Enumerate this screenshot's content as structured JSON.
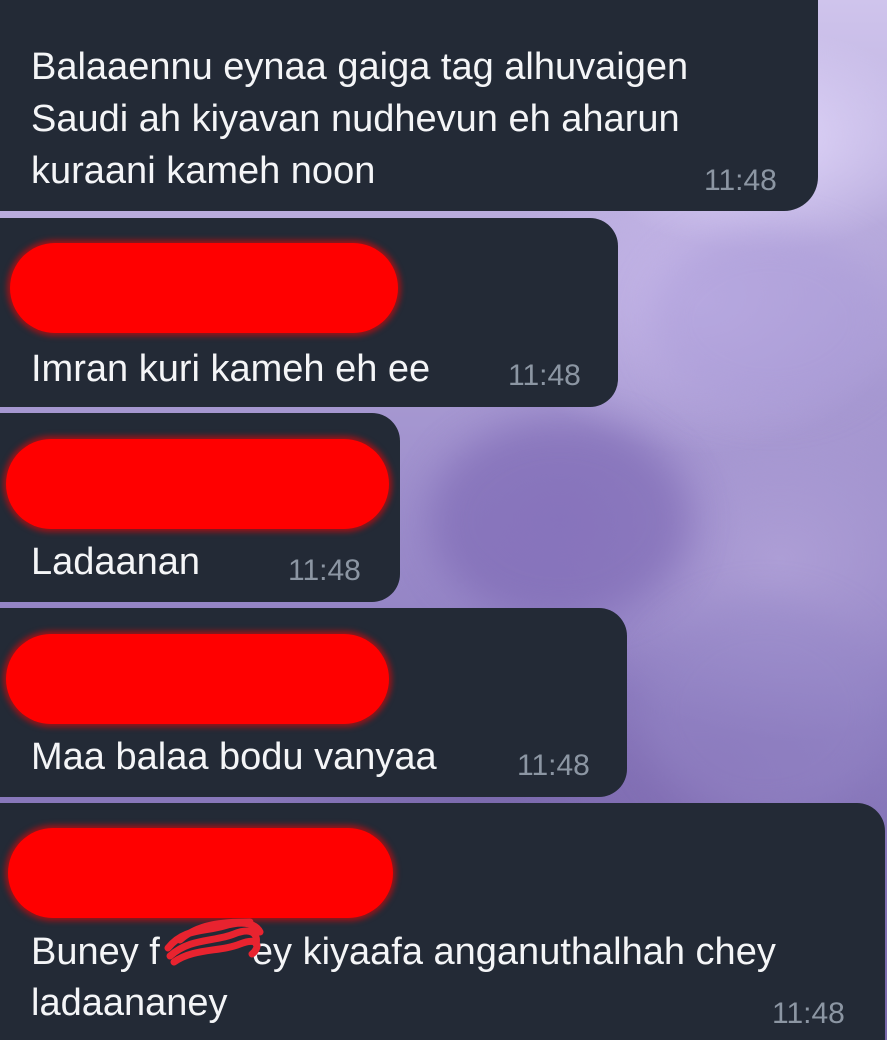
{
  "messages": [
    {
      "id": "m1",
      "text_lines": [
        "Balaaennu eynaa gaiga tag alhuvaigen",
        "Saudi ah kiyavan nudhevun eh aharun",
        "kuraani kameh noon"
      ],
      "time": "11:48",
      "sender_redacted": true
    },
    {
      "id": "m2",
      "text_lines": [
        "Imran kuri kameh eh ee"
      ],
      "time": "11:48",
      "sender_redacted": true
    },
    {
      "id": "m3",
      "text_lines": [
        "Ladaanan"
      ],
      "time": "11:48",
      "sender_redacted": true
    },
    {
      "id": "m4",
      "text_lines": [
        "Maa balaa bodu vanyaa"
      ],
      "time": "11:48",
      "sender_redacted": true
    },
    {
      "id": "m5",
      "text_lines": [
        "Buney f",
        "ey kiyaafa anganuthalhah chey",
        "ladaananey"
      ],
      "time": "11:48",
      "sender_redacted": true,
      "partial_redaction": true
    }
  ],
  "colors": {
    "bubble": "#232a36",
    "text": "#f4f5f7",
    "time": "#8c96a3",
    "redaction": "#ff0000"
  }
}
